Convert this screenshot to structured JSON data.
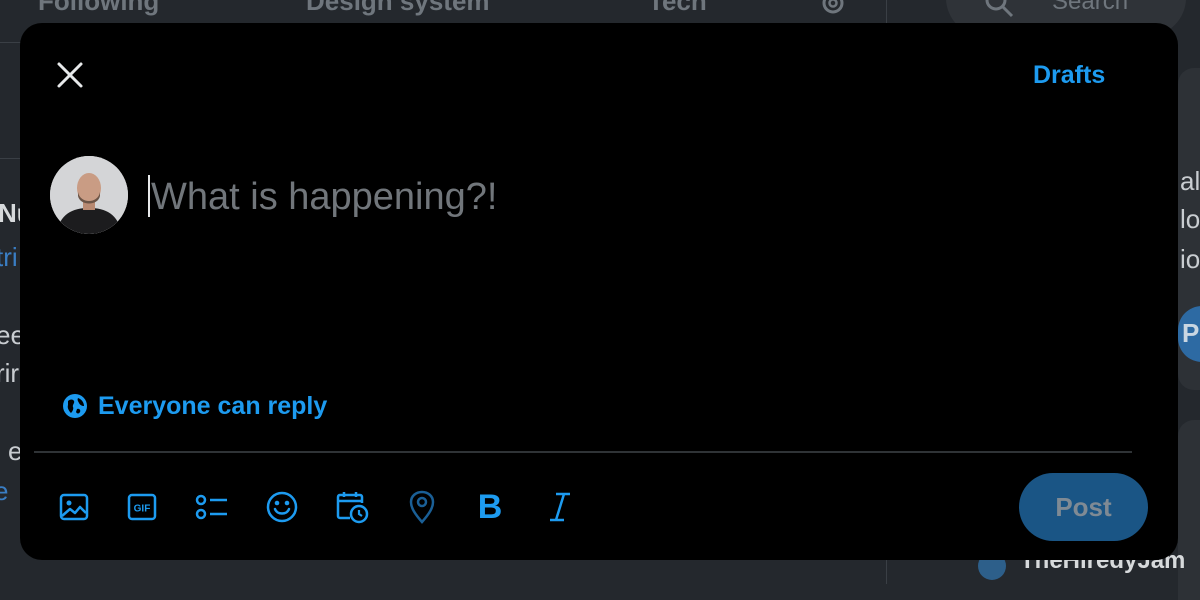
{
  "background": {
    "tabs": [
      "Following",
      "Design system",
      "Tech"
    ],
    "search_placeholder": "Search",
    "left_fragments": [
      "Nu",
      "tri",
      "ee",
      "rir",
      "e",
      "e"
    ],
    "right_fragments": [
      "al l",
      "lo",
      "io",
      "Pr"
    ],
    "bottom_right_name": "TheHiredyJam"
  },
  "modal": {
    "close_icon": "close-icon",
    "drafts_label": "Drafts",
    "compose": {
      "placeholder": "What is happening?!",
      "value": ""
    },
    "reply_setting": {
      "icon": "globe-icon",
      "label": "Everyone can reply"
    },
    "toolbar": [
      {
        "name": "media-button",
        "icon": "image-icon"
      },
      {
        "name": "gif-button",
        "icon": "gif-icon"
      },
      {
        "name": "poll-button",
        "icon": "poll-icon"
      },
      {
        "name": "emoji-button",
        "icon": "emoji-icon"
      },
      {
        "name": "schedule-button",
        "icon": "schedule-icon"
      },
      {
        "name": "location-button",
        "icon": "location-icon"
      },
      {
        "name": "bold-button",
        "icon": "bold-icon",
        "label": "B"
      },
      {
        "name": "italic-button",
        "icon": "italic-icon"
      }
    ],
    "post_label": "Post"
  },
  "colors": {
    "accent": "#1d9bf0",
    "post_disabled_bg": "#1a5585",
    "modal_bg": "#000000",
    "backdrop": "#24282d"
  }
}
